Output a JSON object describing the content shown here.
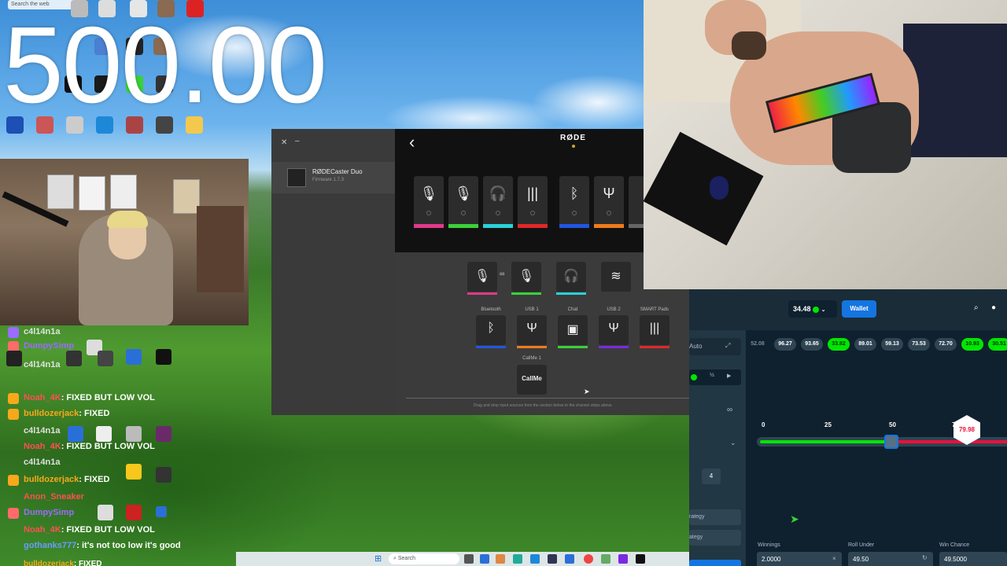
{
  "desktop": {
    "search_placeholder": "Search the web",
    "balance": "500.00"
  },
  "rode": {
    "device_name": "RØDECaster Duo",
    "firmware": "Firmware 1.7.3",
    "brand": "RØDE",
    "back_icon": "chevron-left-icon",
    "channels": [
      {
        "icon": "mic-1-icon",
        "color": "#e0398a"
      },
      {
        "icon": "mic-2-icon",
        "color": "#3ad13a"
      },
      {
        "icon": "headphones-icon",
        "color": "#2ad1d8"
      },
      {
        "icon": "sound-pad-icon",
        "color": "#e02828"
      },
      {
        "icon": "bluetooth-icon",
        "color": "#2255e0"
      },
      {
        "icon": "usb-icon",
        "color": "#ef7b1a"
      }
    ],
    "top_sources": [
      {
        "icon": "mic-1-icon",
        "color": "#e0398a"
      },
      {
        "icon": "mic-2-icon",
        "color": "#3ad13a"
      },
      {
        "icon": "headphones-icon",
        "color": "#2ad1d8"
      },
      {
        "icon": "wifi-icon",
        "color": "#3b3b3b"
      }
    ],
    "sources": [
      {
        "label": "Bluetooth",
        "icon": "bluetooth-icon",
        "color": "#2255e0"
      },
      {
        "label": "USB 1",
        "icon": "usb-icon",
        "color": "#ef7b1a"
      },
      {
        "label": "Chat",
        "icon": "chat-icon",
        "color": "#3ad13a"
      },
      {
        "label": "USB 2",
        "icon": "usb-icon",
        "color": "#7a2ae0"
      },
      {
        "label": "SMART Pads",
        "icon": "sound-pad-icon",
        "color": "#e02828"
      }
    ],
    "callme_label": "CallMe 1",
    "callme_button": "CallMe",
    "hint": "Drag and drop input sources from the section below to the channel strips above"
  },
  "bet": {
    "balance": "34.48",
    "wallet_button": "Wallet",
    "auto_tab": "Auto",
    "history": [
      {
        "value": "52.08",
        "win": false
      },
      {
        "value": "96.27",
        "win": false
      },
      {
        "value": "93.65",
        "win": false
      },
      {
        "value": "33.82",
        "win": true
      },
      {
        "value": "89.01",
        "win": false
      },
      {
        "value": "59.13",
        "win": false
      },
      {
        "value": "73.53",
        "win": false
      },
      {
        "value": "72.70",
        "win": false
      },
      {
        "value": "10.93",
        "win": true
      },
      {
        "value": "30.51",
        "win": true
      }
    ],
    "slider_ticks": [
      "0",
      "25",
      "50",
      "7"
    ],
    "result": "79.98",
    "slider_value": 49.5,
    "side_number": "4",
    "side_strategy_1": "rategy",
    "side_strategy_2": "ategy",
    "fields": [
      {
        "label": "Winnings",
        "value": "2.0000"
      },
      {
        "label": "Roll Under",
        "value": "49.50"
      },
      {
        "label": "Win Chance",
        "value": "49.5000"
      }
    ],
    "colors": {
      "green": "#00e701",
      "red": "#e9113c",
      "blue": "#1475e1"
    }
  },
  "chat": {
    "lines": [
      {
        "user": "c4l14n1a",
        "text": "",
        "color": "#e0e0e0"
      },
      {
        "user": "DumpySimp",
        "text": "",
        "color": "#9a6cff"
      },
      {
        "user": "c4l14n1a",
        "text": "",
        "color": "#e0e0e0"
      },
      {
        "user": "Noah_4K",
        "text": ": FIXED BUT LOW VOL",
        "color": "#ff5050"
      },
      {
        "user": "bulldozerjack",
        "text": ": FIXED",
        "color": "#f7a81b"
      },
      {
        "user": "c4l14n1a",
        "text": "",
        "color": "#e0e0e0"
      },
      {
        "user": "Noah_4K",
        "text": ": FIXED BUT LOW VOL",
        "color": "#ff5050"
      },
      {
        "user": "c4l14n1a",
        "text": "",
        "color": "#e0e0e0"
      },
      {
        "user": "bulldozerjack",
        "text": ": FIXED",
        "color": "#f7a81b"
      },
      {
        "user": "Anon_Sneaker",
        "text": "",
        "color": "#ff5050"
      },
      {
        "user": "DumpySimp",
        "text": "",
        "color": "#9a6cff"
      },
      {
        "user": "Noah_4K",
        "text": ": FIXED BUT LOW VOL",
        "color": "#ff5050"
      },
      {
        "user": "gothanks777",
        "text": ": it's not too low it's good",
        "color": "#6a9cff"
      },
      {
        "user": "bulldozerjack",
        "text": ": FIXED",
        "color": "#f7a81b"
      }
    ]
  },
  "taskbar": {
    "search_placeholder": "Search"
  }
}
